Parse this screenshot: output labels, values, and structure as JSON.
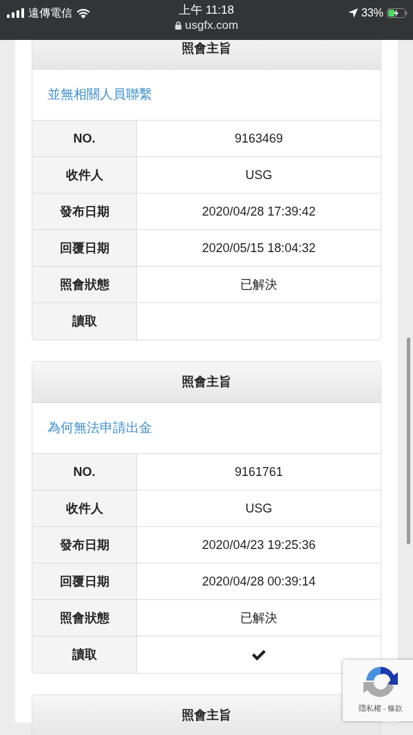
{
  "status_bar": {
    "carrier": "遠傳電信",
    "time": "上午 11:18",
    "url": "usgfx.com",
    "battery": "33%"
  },
  "cards": [
    {
      "header": "照會主旨",
      "subject": "並無相關人員聯繫",
      "rows": [
        {
          "label": "NO.",
          "value": "9163469"
        },
        {
          "label": "收件人",
          "value": "USG"
        },
        {
          "label": "發布日期",
          "value": "2020/04/28 17:39:42"
        },
        {
          "label": "回覆日期",
          "value": "2020/05/15 18:04:32"
        },
        {
          "label": "照會狀態",
          "value": "已解決"
        }
      ],
      "read": {
        "label": "讀取",
        "checked": false
      }
    },
    {
      "header": "照會主旨",
      "subject": "為何無法申請出金",
      "rows": [
        {
          "label": "NO.",
          "value": "9161761"
        },
        {
          "label": "收件人",
          "value": "USG"
        },
        {
          "label": "發布日期",
          "value": "2020/04/23 19:25:36"
        },
        {
          "label": "回覆日期",
          "value": "2020/04/28 00:39:14"
        },
        {
          "label": "照會狀態",
          "value": "已解決"
        }
      ],
      "read": {
        "label": "讀取",
        "checked": true
      }
    },
    {
      "header": "照會主旨"
    }
  ],
  "recaptcha": {
    "links": "隱私權 - 條款"
  }
}
